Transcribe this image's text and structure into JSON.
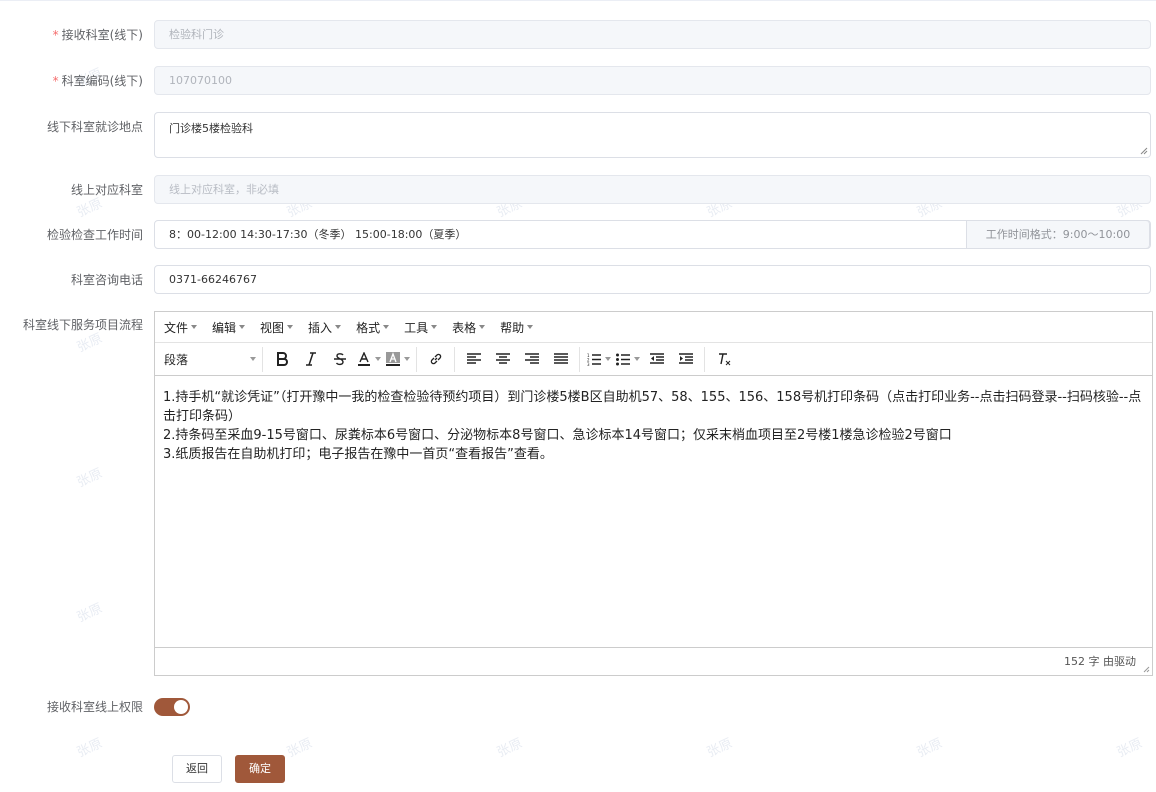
{
  "form": {
    "receive_dept": {
      "label": "接收科室(线下)",
      "required_mark": "*",
      "value": "检验科门诊"
    },
    "dept_code": {
      "label": "科室编码(线下)",
      "required_mark": "*",
      "value": "107070100"
    },
    "location": {
      "label": "线下科室就诊地点",
      "value": "门诊楼5楼检验科"
    },
    "online_dept": {
      "label": "线上对应科室",
      "placeholder": "线上对应科室，非必填"
    },
    "work_time": {
      "label": "检验检查工作时间",
      "value": "8：00-12:00 14:30-17:30（冬季） 15:00-18:00（夏季）",
      "hint": "工作时间格式：9:00～10:00"
    },
    "phone": {
      "label": "科室咨询电话",
      "value": "0371-66246767"
    },
    "process": {
      "label": "科室线下服务项目流程"
    },
    "online_permission": {
      "label": "接收科室线上权限",
      "enabled": true
    }
  },
  "editor": {
    "menus": [
      "文件",
      "编辑",
      "视图",
      "插入",
      "格式",
      "工具",
      "表格",
      "帮助"
    ],
    "block_format": "段落",
    "toolbar_icons": [
      "bold-icon",
      "italic-icon",
      "strikethrough-icon",
      "font-color-icon",
      "background-color-icon",
      "link-icon",
      "align-left-icon",
      "align-center-icon",
      "align-right-icon",
      "align-justify-icon",
      "numbered-list-icon",
      "bullet-list-icon",
      "outdent-icon",
      "indent-icon",
      "clear-format-icon"
    ],
    "paragraphs": [
      "1.持手机“就诊凭证”（打开豫中一我的检查检验待预约项目）到门诊楼5楼B区自助机57、58、155、156、158号机打印条码（点击打印业务--点击扫码登录--扫码核验--点击打印条码）",
      "2.持条码至采血9-15号窗口、尿粪标本6号窗口、分泌物标本8号窗口、急诊标本14号窗口；仅采末梢血项目至2号楼1楼急诊检验2号窗口",
      "3.纸质报告在自助机打印；电子报告在豫中一首页“查看报告”查看。"
    ],
    "status": "152 字 由驱动"
  },
  "buttons": {
    "back": "返回",
    "confirm": "确定"
  },
  "watermark": "张原",
  "colors": {
    "accent": "#a0583a",
    "required": "#f56c6c"
  }
}
